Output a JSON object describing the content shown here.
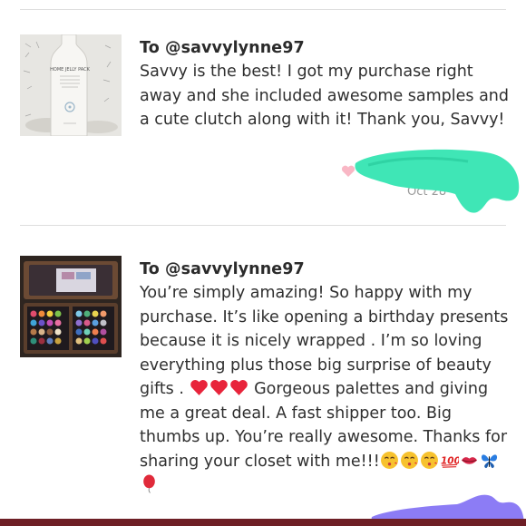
{
  "colors": {
    "scribble_teal": "#3fe6b6",
    "scribble_purple": "#8c7cf5",
    "heart": "#f9b7c5",
    "bottom_bar": "#6e1f26",
    "heart_emoji": "#e8243b"
  },
  "reviews": [
    {
      "recipient": "To @savvylynne97",
      "message": "Savvy is the best! I got my purchase right away and she included awesome samples and a cute clutch along with it! Thank you, Savvy!",
      "date": "Oct 28",
      "thumbnail": "white-jelly-pack-bottle",
      "thumbnail_label": "HOME JELLY PACK"
    },
    {
      "recipient": "To @savvylynne97",
      "message_part1": "You’re simply amazing! So happy with my purchase. It’s like opening a birthday presents because it is nicely wrapped . I’m so loving everything plus those big surprise of beauty gifts . ",
      "message_part2": " Gorgeous palettes and giving me a great deal. A fast shipper too. Big thumbs up. You’re really awesome. Thanks for sharing your closet with me!!!",
      "thumbnail": "makeup-palette-case",
      "emoji_names": [
        "heart-emoji",
        "kiss-emoji",
        "100-emoji",
        "lips-emoji",
        "butterfly-emoji",
        "balloon-emoji"
      ]
    }
  ]
}
